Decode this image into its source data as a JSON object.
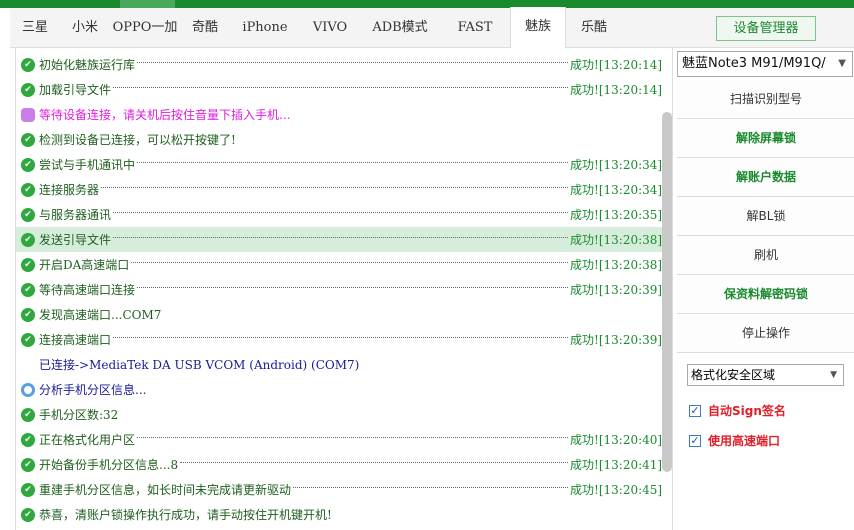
{
  "tabs": [
    "三星",
    "小米",
    "OPPO一加",
    "奇酷",
    "iPhone",
    "VIVO",
    "ADB模式",
    "FAST",
    "魅族",
    "乐酷"
  ],
  "active_tab": "魅族",
  "device_manager": "设备管理器",
  "model_select": "魅蓝Note3 M91/M91Q/",
  "buttons": [
    "扫描识别型号",
    "解除屏幕锁",
    "解账户数据",
    "解BL锁",
    "刷机",
    "保资料解密码锁",
    "停止操作"
  ],
  "format_select": "格式化安全区域",
  "checkboxes": [
    {
      "label": "自动Sign签名",
      "checked": true
    },
    {
      "label": "使用高速端口",
      "checked": true
    }
  ],
  "log": [
    {
      "text": "初始化魅族运行库",
      "type": "ok",
      "status": "成功![13:20:14]"
    },
    {
      "text": "加载引导文件",
      "type": "ok",
      "status": "成功![13:20:14]"
    },
    {
      "text": "等待设备连接，请关机后按住音量下插入手机...",
      "type": "warn"
    },
    {
      "text": "检测到设备已连接，可以松开按键了!",
      "type": "ok"
    },
    {
      "text": "尝试与手机通讯中",
      "type": "ok",
      "status": "成功![13:20:34]"
    },
    {
      "text": "连接服务器",
      "type": "ok",
      "status": "成功![13:20:34]"
    },
    {
      "text": "与服务器通讯",
      "type": "ok",
      "status": "成功![13:20:35]"
    },
    {
      "text": "发送引导文件",
      "type": "ok",
      "status": "成功![13:20:38]",
      "selected": true
    },
    {
      "text": "开启DA高速端口",
      "type": "ok",
      "status": "成功![13:20:38]"
    },
    {
      "text": "等待高速端口连接",
      "type": "ok",
      "status": "成功![13:20:39]"
    },
    {
      "text": "发现高速端口...COM7",
      "type": "ok"
    },
    {
      "text": "连接高速端口",
      "type": "ok",
      "status": "成功![13:20:39]"
    },
    {
      "text": "已连接->MediaTek DA USB VCOM (Android) (COM7)",
      "type": "info"
    },
    {
      "text": "分析手机分区信息...",
      "type": "prog"
    },
    {
      "text": "手机分区数:32",
      "type": "ok"
    },
    {
      "text": "正在格式化用户区",
      "type": "ok",
      "status": "成功![13:20:40]"
    },
    {
      "text": "开始备份手机分区信息...8",
      "type": "ok",
      "status": "成功![13:20:41]"
    },
    {
      "text": "重建手机分区信息，如长时间未完成请更新驱动",
      "type": "ok",
      "status": "成功![13:20:45]"
    },
    {
      "text": "恭喜，清账户锁操作执行成功，请手动按住开机键开机!",
      "type": "ok"
    }
  ]
}
